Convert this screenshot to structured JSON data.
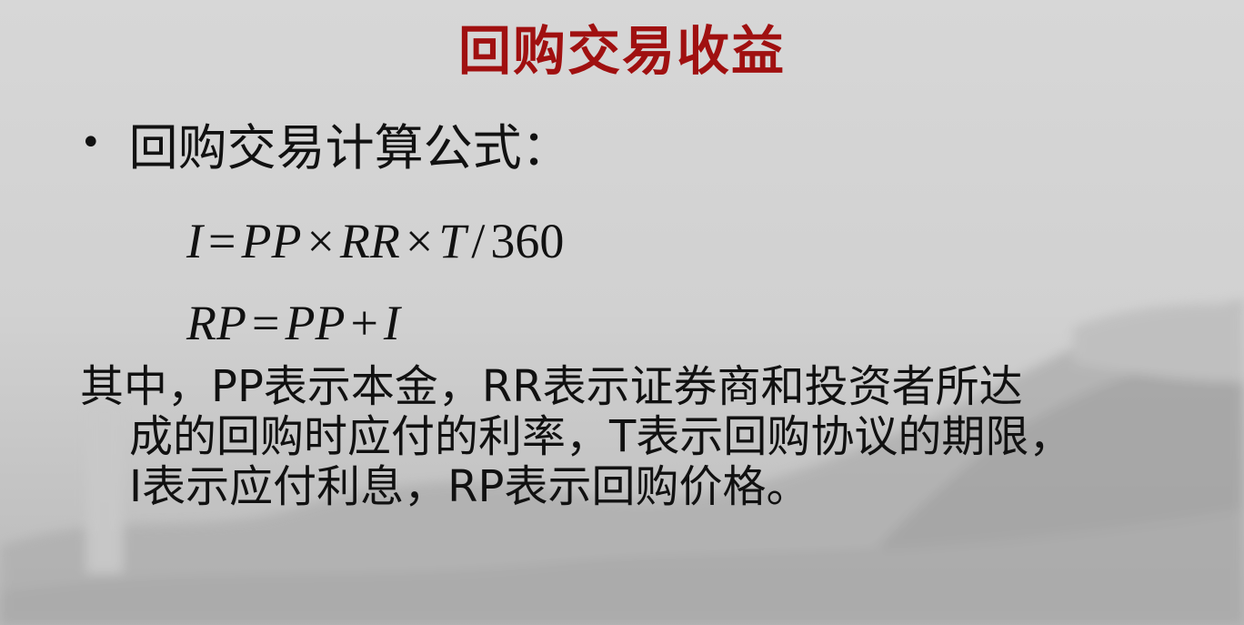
{
  "slide": {
    "title": "回购交易收益",
    "bullet": {
      "marker": "•",
      "text": "回购交易计算公式："
    },
    "formula_1": {
      "lhs": "I",
      "eq": "=",
      "t1": "PP",
      "x1": "×",
      "t2": "RR",
      "x2": "×",
      "t3": "T",
      "div": "/",
      "t4": "360"
    },
    "formula_2": {
      "lhs": "RP",
      "eq": "=",
      "t1": "PP",
      "plus": "+",
      "t2": "I"
    },
    "description": {
      "line1": "其中，PP表示本金，RR表示证券商和投资者所达",
      "line2": "成的回购时应付的利率，T表示回购协议的期限，",
      "line3": "I表示应付利息，RP表示回购价格。"
    }
  }
}
